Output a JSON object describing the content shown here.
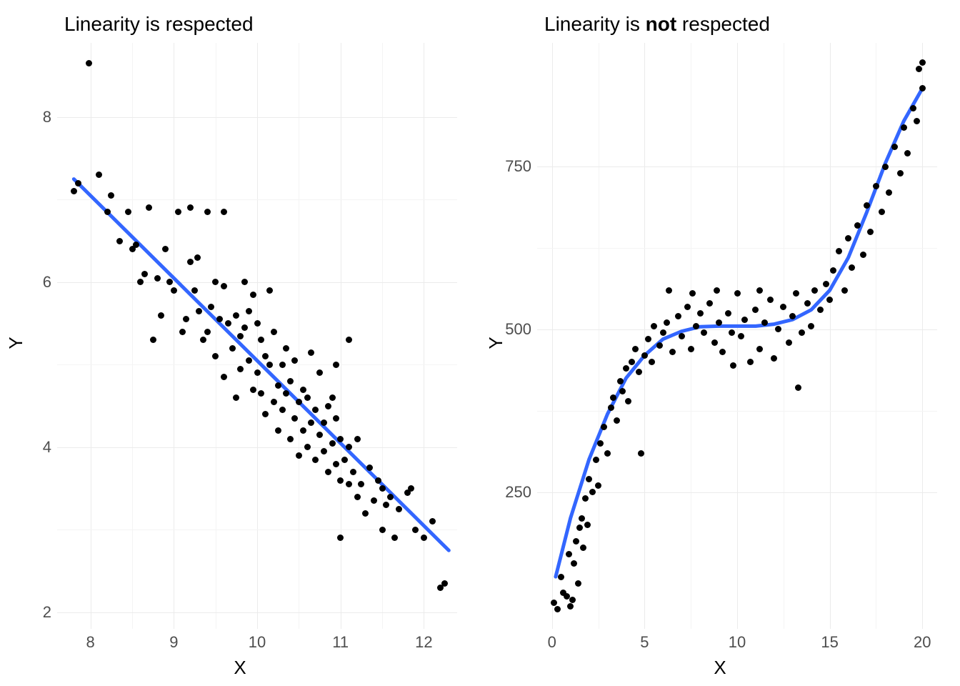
{
  "chart_data": [
    {
      "type": "scatter",
      "title": "Linearity is respected",
      "xlabel": "X",
      "ylabel": "Y",
      "xticks": [
        8,
        9,
        10,
        11,
        12
      ],
      "yticks": [
        2,
        4,
        6,
        8
      ],
      "xlim": [
        7.6,
        12.4
      ],
      "ylim": [
        1.8,
        8.9
      ],
      "trend": {
        "type": "linear",
        "color": "#3366ff",
        "x1": 7.8,
        "y1": 7.25,
        "x2": 12.3,
        "y2": 2.75
      },
      "points": [
        [
          7.98,
          8.65
        ],
        [
          7.8,
          7.1
        ],
        [
          7.85,
          7.2
        ],
        [
          8.1,
          7.3
        ],
        [
          8.2,
          6.85
        ],
        [
          8.25,
          7.05
        ],
        [
          8.35,
          6.5
        ],
        [
          8.45,
          6.85
        ],
        [
          8.5,
          6.4
        ],
        [
          8.55,
          6.45
        ],
        [
          8.6,
          6.0
        ],
        [
          8.65,
          6.1
        ],
        [
          8.7,
          6.9
        ],
        [
          8.75,
          5.3
        ],
        [
          8.8,
          6.05
        ],
        [
          8.85,
          5.6
        ],
        [
          8.9,
          6.4
        ],
        [
          8.95,
          6.0
        ],
        [
          9.0,
          5.9
        ],
        [
          9.05,
          6.85
        ],
        [
          9.1,
          5.4
        ],
        [
          9.15,
          5.55
        ],
        [
          9.2,
          6.25
        ],
        [
          9.2,
          6.9
        ],
        [
          9.25,
          5.9
        ],
        [
          9.28,
          6.3
        ],
        [
          9.3,
          5.65
        ],
        [
          9.35,
          5.3
        ],
        [
          9.4,
          5.4
        ],
        [
          9.4,
          6.85
        ],
        [
          9.45,
          5.7
        ],
        [
          9.5,
          6.0
        ],
        [
          9.5,
          5.1
        ],
        [
          9.55,
          5.55
        ],
        [
          9.6,
          4.85
        ],
        [
          9.6,
          5.95
        ],
        [
          9.6,
          6.85
        ],
        [
          9.65,
          5.5
        ],
        [
          9.7,
          5.2
        ],
        [
          9.75,
          5.6
        ],
        [
          9.75,
          4.6
        ],
        [
          9.8,
          5.35
        ],
        [
          9.8,
          4.95
        ],
        [
          9.85,
          5.45
        ],
        [
          9.85,
          6.0
        ],
        [
          9.9,
          5.05
        ],
        [
          9.9,
          5.65
        ],
        [
          9.95,
          4.7
        ],
        [
          9.95,
          5.85
        ],
        [
          10.0,
          4.9
        ],
        [
          10.0,
          5.5
        ],
        [
          10.05,
          4.65
        ],
        [
          10.05,
          5.3
        ],
        [
          10.1,
          4.4
        ],
        [
          10.1,
          5.1
        ],
        [
          10.15,
          5.0
        ],
        [
          10.15,
          5.9
        ],
        [
          10.2,
          4.55
        ],
        [
          10.2,
          5.4
        ],
        [
          10.25,
          4.75
        ],
        [
          10.25,
          4.2
        ],
        [
          10.3,
          5.0
        ],
        [
          10.3,
          4.45
        ],
        [
          10.35,
          4.65
        ],
        [
          10.35,
          5.2
        ],
        [
          10.4,
          4.1
        ],
        [
          10.4,
          4.8
        ],
        [
          10.45,
          4.35
        ],
        [
          10.45,
          5.05
        ],
        [
          10.5,
          4.55
        ],
        [
          10.5,
          3.9
        ],
        [
          10.55,
          4.2
        ],
        [
          10.55,
          4.7
        ],
        [
          10.6,
          4.0
        ],
        [
          10.6,
          4.6
        ],
        [
          10.65,
          4.3
        ],
        [
          10.65,
          5.15
        ],
        [
          10.7,
          3.85
        ],
        [
          10.7,
          4.45
        ],
        [
          10.75,
          4.15
        ],
        [
          10.75,
          4.9
        ],
        [
          10.8,
          3.95
        ],
        [
          10.8,
          4.3
        ],
        [
          10.85,
          4.5
        ],
        [
          10.85,
          3.7
        ],
        [
          10.9,
          4.05
        ],
        [
          10.9,
          4.6
        ],
        [
          10.95,
          3.8
        ],
        [
          10.95,
          4.35
        ],
        [
          11.0,
          3.6
        ],
        [
          11.0,
          4.1
        ],
        [
          11.05,
          3.85
        ],
        [
          11.1,
          4.0
        ],
        [
          11.1,
          3.55
        ],
        [
          11.15,
          3.7
        ],
        [
          11.2,
          3.4
        ],
        [
          11.2,
          4.1
        ],
        [
          11.25,
          3.55
        ],
        [
          11.3,
          3.2
        ],
        [
          11.35,
          3.75
        ],
        [
          11.4,
          3.35
        ],
        [
          11.45,
          3.6
        ],
        [
          11.5,
          3.0
        ],
        [
          11.5,
          3.5
        ],
        [
          11.55,
          3.3
        ],
        [
          11.6,
          3.4
        ],
        [
          11.65,
          2.9
        ],
        [
          11.7,
          3.25
        ],
        [
          11.8,
          3.45
        ],
        [
          11.85,
          3.5
        ],
        [
          11.9,
          3.0
        ],
        [
          12.0,
          2.9
        ],
        [
          12.1,
          3.1
        ],
        [
          12.2,
          2.3
        ],
        [
          12.25,
          2.35
        ],
        [
          11.1,
          5.3
        ],
        [
          10.95,
          5.0
        ],
        [
          11.0,
          2.9
        ]
      ]
    },
    {
      "type": "scatter",
      "title_html": "Linearity is <b>not</b> respected",
      "xlabel": "X",
      "ylabel": "Y",
      "xticks": [
        0,
        5,
        10,
        15,
        20
      ],
      "yticks": [
        250,
        500,
        750
      ],
      "xlim": [
        -0.8,
        20.8
      ],
      "ylim": [
        40,
        940
      ],
      "trend": {
        "type": "curve",
        "color": "#3366ff",
        "path": [
          [
            0.2,
            120
          ],
          [
            1,
            210
          ],
          [
            2,
            300
          ],
          [
            3,
            370
          ],
          [
            4,
            425
          ],
          [
            5,
            460
          ],
          [
            6,
            485
          ],
          [
            7,
            497
          ],
          [
            8,
            504
          ],
          [
            9,
            505
          ],
          [
            10,
            505
          ],
          [
            11,
            505
          ],
          [
            12,
            508
          ],
          [
            13,
            515
          ],
          [
            14,
            530
          ],
          [
            15,
            560
          ],
          [
            16,
            610
          ],
          [
            17,
            680
          ],
          [
            18,
            755
          ],
          [
            19,
            820
          ],
          [
            20,
            870
          ]
        ]
      },
      "points": [
        [
          0.1,
          80
        ],
        [
          0.3,
          70
        ],
        [
          0.5,
          120
        ],
        [
          0.6,
          95
        ],
        [
          0.8,
          90
        ],
        [
          0.9,
          155
        ],
        [
          1.0,
          75
        ],
        [
          1.1,
          85
        ],
        [
          1.2,
          140
        ],
        [
          1.3,
          175
        ],
        [
          1.4,
          110
        ],
        [
          1.5,
          195
        ],
        [
          1.6,
          210
        ],
        [
          1.7,
          165
        ],
        [
          1.8,
          240
        ],
        [
          1.9,
          200
        ],
        [
          2.0,
          270
        ],
        [
          2.2,
          250
        ],
        [
          2.4,
          300
        ],
        [
          2.5,
          260
        ],
        [
          2.6,
          325
        ],
        [
          2.8,
          350
        ],
        [
          3.0,
          310
        ],
        [
          3.2,
          380
        ],
        [
          3.3,
          395
        ],
        [
          3.5,
          360
        ],
        [
          3.7,
          420
        ],
        [
          3.8,
          405
        ],
        [
          4.0,
          440
        ],
        [
          4.1,
          390
        ],
        [
          4.3,
          450
        ],
        [
          4.5,
          470
        ],
        [
          4.7,
          435
        ],
        [
          4.8,
          310
        ],
        [
          5.0,
          460
        ],
        [
          5.2,
          485
        ],
        [
          5.4,
          450
        ],
        [
          5.5,
          505
        ],
        [
          5.8,
          475
        ],
        [
          6.0,
          495
        ],
        [
          6.2,
          510
        ],
        [
          6.5,
          465
        ],
        [
          6.8,
          520
        ],
        [
          7.0,
          490
        ],
        [
          7.3,
          535
        ],
        [
          7.5,
          470
        ],
        [
          7.8,
          505
        ],
        [
          8.0,
          525
        ],
        [
          8.2,
          495
        ],
        [
          8.5,
          540
        ],
        [
          8.8,
          480
        ],
        [
          9.0,
          510
        ],
        [
          9.2,
          465
        ],
        [
          9.5,
          525
        ],
        [
          9.7,
          495
        ],
        [
          10.0,
          555
        ],
        [
          10.2,
          490
        ],
        [
          10.4,
          515
        ],
        [
          10.7,
          450
        ],
        [
          11.0,
          530
        ],
        [
          11.2,
          470
        ],
        [
          11.5,
          510
        ],
        [
          11.8,
          545
        ],
        [
          12.0,
          455
        ],
        [
          12.2,
          500
        ],
        [
          12.5,
          535
        ],
        [
          12.8,
          480
        ],
        [
          13.0,
          520
        ],
        [
          13.2,
          555
        ],
        [
          13.3,
          410
        ],
        [
          13.5,
          495
        ],
        [
          13.8,
          540
        ],
        [
          14.0,
          505
        ],
        [
          14.2,
          560
        ],
        [
          14.5,
          530
        ],
        [
          14.8,
          570
        ],
        [
          15.0,
          545
        ],
        [
          15.2,
          590
        ],
        [
          15.5,
          620
        ],
        [
          15.8,
          560
        ],
        [
          16.0,
          640
        ],
        [
          16.2,
          595
        ],
        [
          16.5,
          660
        ],
        [
          16.8,
          615
        ],
        [
          17.0,
          690
        ],
        [
          17.2,
          650
        ],
        [
          17.5,
          720
        ],
        [
          17.8,
          680
        ],
        [
          18.0,
          750
        ],
        [
          18.2,
          710
        ],
        [
          18.5,
          780
        ],
        [
          18.8,
          740
        ],
        [
          19.0,
          810
        ],
        [
          19.2,
          770
        ],
        [
          19.5,
          840
        ],
        [
          19.7,
          820
        ],
        [
          19.8,
          900
        ],
        [
          20.0,
          870
        ],
        [
          20.0,
          910
        ],
        [
          6.3,
          560
        ],
        [
          7.6,
          555
        ],
        [
          8.9,
          560
        ],
        [
          9.8,
          445
        ],
        [
          11.2,
          560
        ]
      ]
    }
  ]
}
